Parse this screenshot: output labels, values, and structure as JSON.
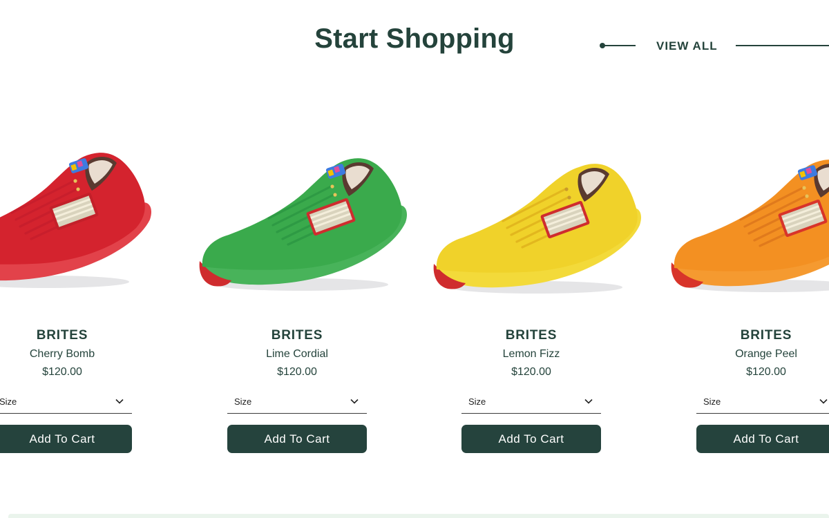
{
  "section": {
    "title": "Start Shopping",
    "view_all": "VIEW ALL"
  },
  "products": [
    {
      "brand": "BRITES",
      "name": "Cherry Bomb",
      "price": "$120.00",
      "size_label": "Size",
      "cart_label": "Add To Cart",
      "colors": {
        "upper": "#d4232e",
        "sole": "#e2424a",
        "heel": "#c3202a",
        "lace": "#c81e2c"
      }
    },
    {
      "brand": "BRITES",
      "name": "Lime Cordial",
      "price": "$120.00",
      "size_label": "Size",
      "cart_label": "Add To Cart",
      "colors": {
        "upper": "#3aaa4c",
        "sole": "#48b35a",
        "heel": "#cf2c2e",
        "lace": "#2e9a44"
      }
    },
    {
      "brand": "BRITES",
      "name": "Lemon Fizz",
      "price": "$120.00",
      "size_label": "Size",
      "cart_label": "Add To Cart",
      "colors": {
        "upper": "#f0d22a",
        "sole": "#f3da3a",
        "heel": "#cf2c2e",
        "lace": "#e2b71e"
      }
    },
    {
      "brand": "BRITES",
      "name": "Orange Peel",
      "price": "$120.00",
      "size_label": "Size",
      "cart_label": "Add To Cart",
      "colors": {
        "upper": "#f39022",
        "sole": "#f59a30",
        "heel": "#d8342a",
        "lace": "#e07a1c"
      }
    }
  ],
  "colors": {
    "brand_dark_green": "#24433b",
    "button_bg": "#25433d",
    "button_text": "#ffffff",
    "bottom_strip": "#eaf4ec"
  }
}
